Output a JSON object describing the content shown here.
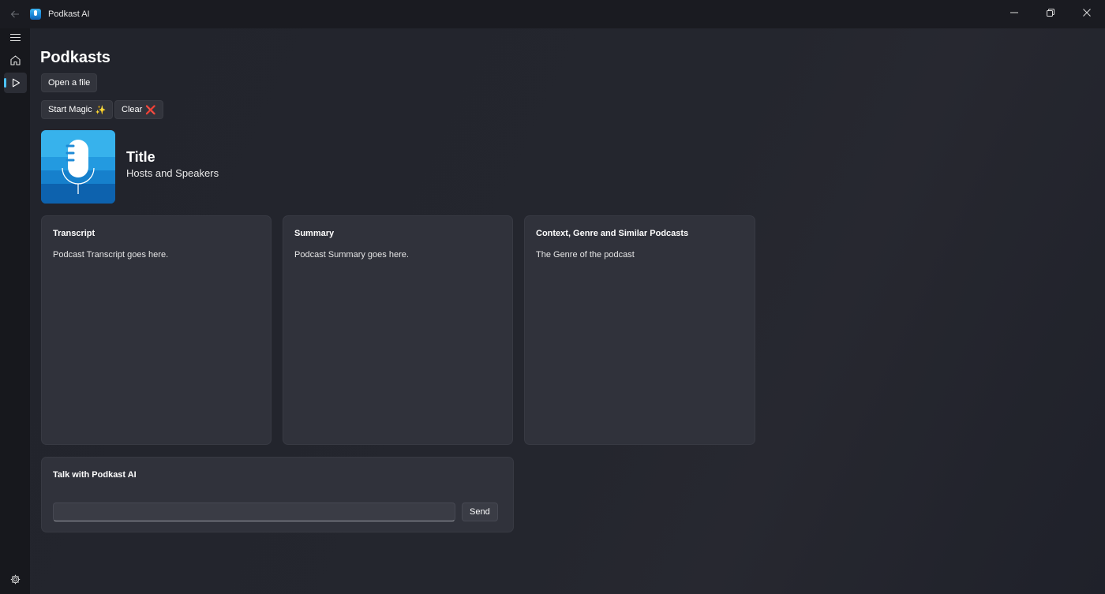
{
  "window": {
    "app_title": "Podkast AI",
    "icons": {
      "back": "back-arrow-icon",
      "minimize": "minimize-icon",
      "restore": "restore-icon",
      "close": "close-icon"
    }
  },
  "sidebar": {
    "items": [
      {
        "icon": "hamburger-menu-icon"
      },
      {
        "icon": "home-icon"
      },
      {
        "icon": "play-icon",
        "active": true
      }
    ],
    "footer_icon": "settings-gear-icon"
  },
  "page": {
    "title": "Podkasts",
    "open_file_label": "Open a file",
    "start_magic_label": "Start Magic",
    "start_magic_emoji": "✨",
    "clear_label": "Clear",
    "clear_emoji": "❌"
  },
  "podcast": {
    "art_icon": "microphone-icon",
    "title": "Title",
    "hosts": "Hosts and Speakers"
  },
  "cards": {
    "transcript": {
      "title": "Transcript",
      "body": "Podcast Transcript goes here."
    },
    "summary": {
      "title": "Summary",
      "body": "Podcast Summary goes here."
    },
    "context": {
      "title": "Context, Genre and Similar Podcasts",
      "body": "The Genre of the podcast"
    }
  },
  "chat": {
    "title": "Talk with Podkast AI",
    "input_value": "",
    "send_label": "Send"
  },
  "colors": {
    "accent": "#4cc2ff",
    "background": "#1c1e25",
    "card": "#30323b",
    "button": "#32343c"
  }
}
